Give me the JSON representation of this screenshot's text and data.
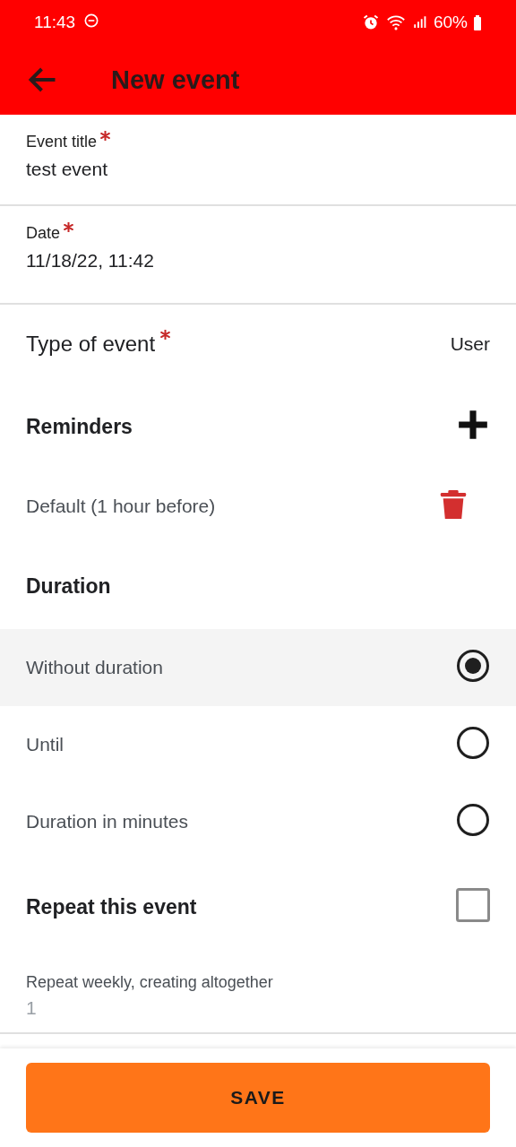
{
  "status_bar": {
    "time": "11:43",
    "battery": "60%"
  },
  "toolbar": {
    "title": "New event"
  },
  "fields": [
    {
      "label": "Event title",
      "value": "test event",
      "required": true
    },
    {
      "label": "Date",
      "value": "11/18/22, 11:42",
      "required": true
    }
  ],
  "event_type": {
    "label": "Type of event",
    "value": "User",
    "required": true
  },
  "reminders": {
    "title": "Reminders",
    "items": [
      {
        "label": "Default (1 hour before)"
      }
    ]
  },
  "duration": {
    "title": "Duration",
    "options": [
      {
        "label": "Without duration",
        "selected": true
      },
      {
        "label": "Until",
        "selected": false
      },
      {
        "label": "Duration in minutes",
        "selected": false
      }
    ]
  },
  "repeat": {
    "label": "Repeat this event",
    "checked": false
  },
  "repeat_count": {
    "label": "Repeat weekly, creating altogether",
    "placeholder": "1"
  },
  "save_button": "SAVE"
}
